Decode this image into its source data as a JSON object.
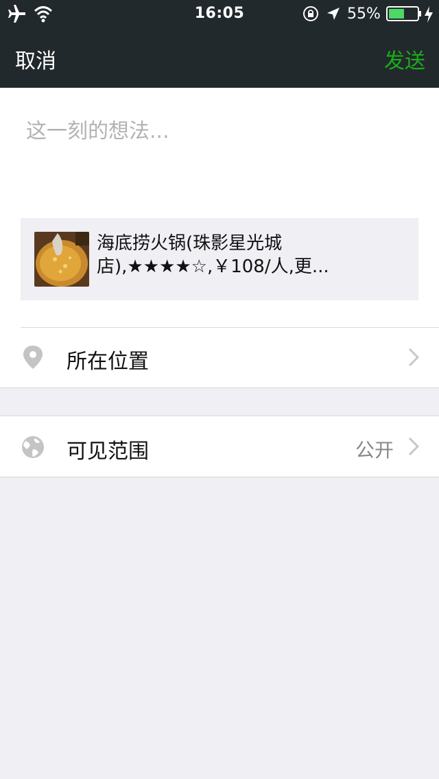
{
  "status_bar": {
    "time": "16:05",
    "battery_percent": "55%",
    "battery_level": 0.55,
    "icons": [
      "airplane-icon",
      "wifi-icon",
      "rotation-lock-icon",
      "location-arrow-icon",
      "battery-icon",
      "charging-icon"
    ]
  },
  "nav": {
    "cancel_label": "取消",
    "send_label": "发送",
    "send_color": "#1aad19"
  },
  "compose": {
    "placeholder": "这一刻的想法..."
  },
  "share_card": {
    "text": "海底捞火锅(珠影星光城店),★★★★☆,￥108/人,更..."
  },
  "location_row": {
    "label": "所在位置",
    "icon": "location-pin-icon"
  },
  "visibility_row": {
    "label": "可见范围",
    "value": "公开",
    "icon": "globe-icon"
  }
}
